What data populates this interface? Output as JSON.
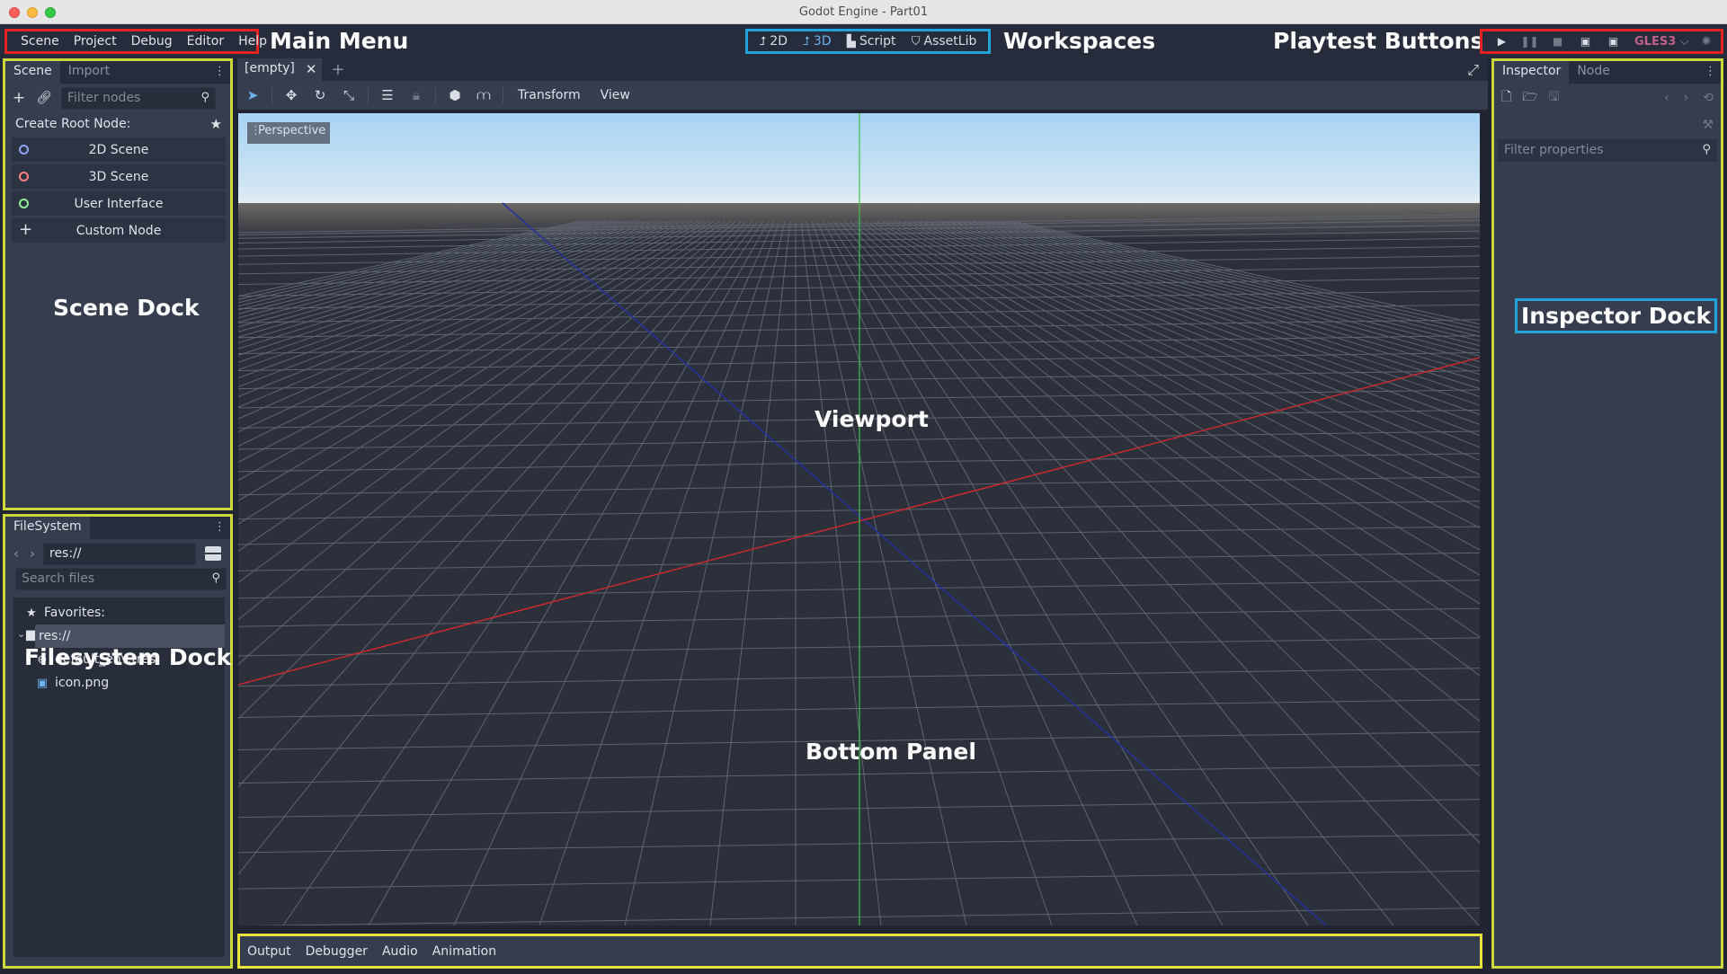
{
  "window": {
    "title": "Godot Engine - Part01"
  },
  "menu": {
    "items": [
      "Scene",
      "Project",
      "Debug",
      "Editor",
      "Help"
    ]
  },
  "workspaces": [
    {
      "label": "2D",
      "icon": "2d-icon",
      "active": false
    },
    {
      "label": "3D",
      "icon": "3d-icon",
      "active": true
    },
    {
      "label": "Script",
      "icon": "script-icon",
      "active": false
    },
    {
      "label": "AssetLib",
      "icon": "assetlib-icon",
      "active": false
    }
  ],
  "playtest": {
    "renderer": "GLES3"
  },
  "annotations": {
    "main_menu": "Main Menu",
    "workspaces": "Workspaces",
    "playtest": "Playtest Buttons",
    "scene_dock": "Scene Dock",
    "filesystem_dock": "Filesystem Dock",
    "viewport": "Viewport",
    "bottom_panel": "Bottom Panel",
    "inspector_dock": "Inspector Dock"
  },
  "scene_dock": {
    "tabs": [
      "Scene",
      "Import"
    ],
    "filter_placeholder": "Filter nodes",
    "create_root_label": "Create Root Node:",
    "root_buttons": [
      {
        "label": "2D Scene",
        "color": "#8da5f3"
      },
      {
        "label": "3D Scene",
        "color": "#fc7f7f"
      },
      {
        "label": "User Interface",
        "color": "#8eef97"
      },
      {
        "label": "Custom Node",
        "color": "#e0e3ea"
      }
    ]
  },
  "filesystem_dock": {
    "tab": "FileSystem",
    "path": "res://",
    "search_placeholder": "Search files",
    "tree": [
      {
        "label": "Favorites:",
        "icon": "star-icon"
      },
      {
        "label": "res://",
        "icon": "folder-icon",
        "selected": true
      },
      {
        "label": "default_env.tres",
        "icon": "globe-icon"
      },
      {
        "label": "icon.png",
        "icon": "image-icon"
      }
    ]
  },
  "editor": {
    "scene_tab": "[empty]",
    "toolbar_menus": [
      "Transform",
      "View"
    ],
    "perspective_label": "Perspective"
  },
  "bottom_panel": {
    "items": [
      "Output",
      "Debugger",
      "Audio",
      "Animation"
    ]
  },
  "inspector": {
    "tabs": [
      "Inspector",
      "Node"
    ],
    "filter_placeholder": "Filter properties"
  },
  "colors": {
    "menu_frame": "#e4221f",
    "workspace_frame": "#20a3d9",
    "dock_frame": "#cdd63a",
    "bottom_frame": "#e8e43a",
    "accent": "#6db4f0",
    "gles": "#c0608c"
  }
}
